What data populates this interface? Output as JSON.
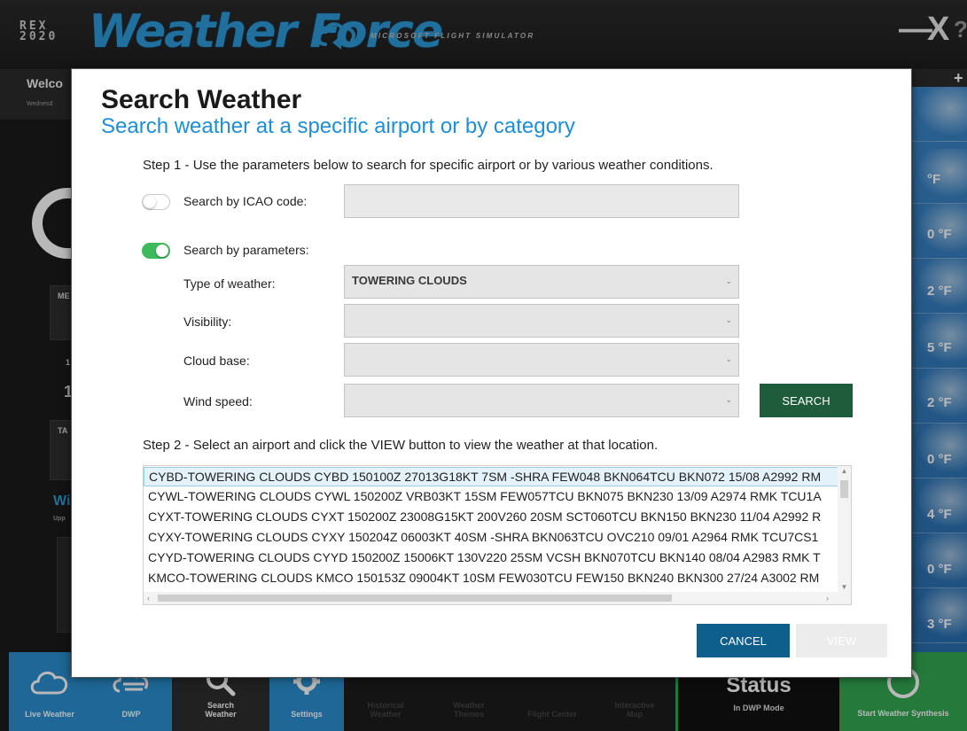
{
  "app": {
    "logo_rex": "REX\n2020",
    "logo_title": "Weather Force",
    "logo_subtitle": "MICROSOFT FLIGHT SIMULATOR",
    "minimize_label": "—",
    "close_label": "X",
    "help_label": "?",
    "welcome": "Welco",
    "welcome_sub": "Wednesd",
    "add_label": "+",
    "left_card1": "ME",
    "left_card2": "TA",
    "left_num_small": "1",
    "left_num_big": "1",
    "left_blue": "Wi",
    "left_blue_sub": "Upp",
    "right_temps": [
      "°F",
      "0 °F",
      "2 °F",
      "5 °F",
      "2 °F",
      "0 °F",
      "4 °F",
      "0 °F",
      "3 °F"
    ]
  },
  "nav": [
    {
      "label": "Live Weather",
      "icon": "cloud-icon"
    },
    {
      "label": "DWP",
      "icon": "dwp-icon"
    },
    {
      "label": "Search\nWeather",
      "icon": "search-icon"
    },
    {
      "label": "Settings",
      "icon": "gear-icon"
    },
    {
      "label": "Historical\nWeather",
      "icon": "history-icon"
    },
    {
      "label": "Weather\nThemes",
      "icon": "themes-icon"
    },
    {
      "label": "Flight Center",
      "icon": "plane-icon"
    },
    {
      "label": "Interactive\nMap",
      "icon": "map-icon"
    }
  ],
  "status": {
    "title": "Status",
    "subtitle": "In DWP Mode"
  },
  "start": {
    "label": "Start Weather Synthesis"
  },
  "modal": {
    "title": "Search Weather",
    "subtitle": "Search weather at a specific airport or by category",
    "step1": "Step 1 - Use the parameters below to search for specific airport or by various weather conditions.",
    "icao_label": "Search by ICAO code:",
    "icao_value": "",
    "icao_toggle_on": false,
    "params_label": "Search by parameters:",
    "params_toggle_on": true,
    "weather_type_label": "Type of weather:",
    "weather_type_value": "TOWERING CLOUDS",
    "visibility_label": "Visibility:",
    "visibility_value": "",
    "cloud_base_label": "Cloud base:",
    "cloud_base_value": "",
    "wind_speed_label": "Wind speed:",
    "wind_speed_value": "",
    "search_button": "SEARCH",
    "step2": "Step 2 - Select an airport and click the VIEW button to view the weather at that location.",
    "results": [
      "CYBD-TOWERING CLOUDS   CYBD 150100Z 27013G18KT 7SM -SHRA FEW048 BKN064TCU BKN072 15/08 A2992 RM",
      "CYWL-TOWERING CLOUDS   CYWL 150200Z VRB03KT 15SM FEW057TCU BKN075 BKN230 13/09 A2974 RMK TCU1A",
      "CYXT-TOWERING CLOUDS   CYXT 150200Z 23008G15KT 200V260 20SM SCT060TCU BKN150 BKN230 11/04 A2992 R",
      "CYXY-TOWERING CLOUDS   CYXY 150204Z 06003KT 40SM -SHRA BKN063TCU OVC210 09/01 A2964 RMK TCU7CS1",
      "CYYD-TOWERING CLOUDS   CYYD 150200Z 15006KT 130V220 25SM VCSH BKN070TCU BKN140 08/04 A2983 RMK T",
      "KMCO-TOWERING CLOUDS   KMCO 150153Z 09004KT 10SM FEW030TCU FEW150 BKN240 BKN300 27/24 A3002 RM"
    ],
    "selected_index": 0,
    "cancel_button": "CANCEL",
    "view_button": "VIEW"
  }
}
